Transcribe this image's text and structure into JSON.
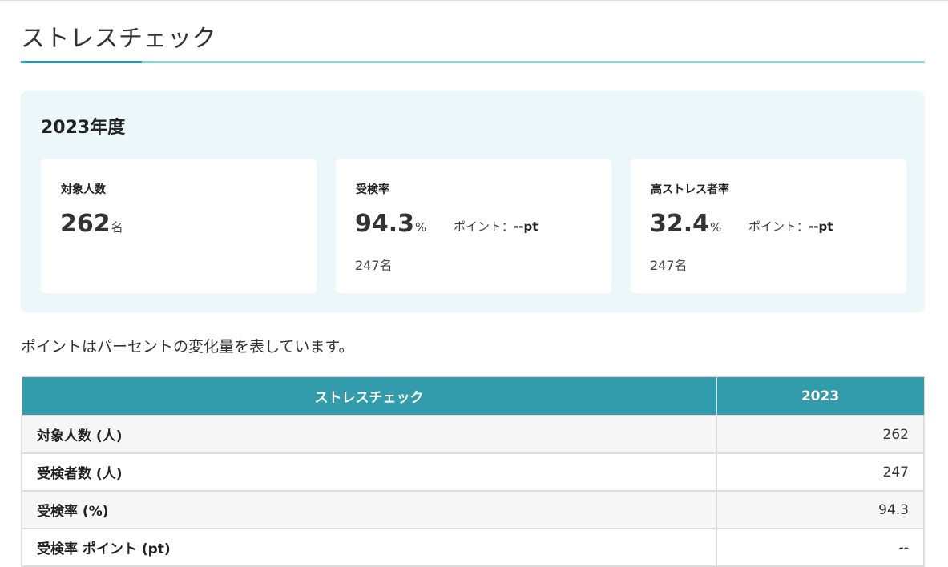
{
  "page": {
    "title": "ストレスチェック"
  },
  "summary": {
    "fiscal_year": "2023年度",
    "cards": [
      {
        "label": "対象人数",
        "value": "262",
        "unit": "名",
        "point_label": "",
        "point_value": "",
        "sub": ""
      },
      {
        "label": "受検率",
        "value": "94.3",
        "unit": "%",
        "point_label": "ポイント：",
        "point_value": "--pt",
        "sub": "247名"
      },
      {
        "label": "高ストレス者率",
        "value": "32.4",
        "unit": "%",
        "point_label": "ポイント：",
        "point_value": "--pt",
        "sub": "247名"
      }
    ]
  },
  "note": "ポイントはパーセントの変化量を表しています。",
  "table": {
    "headers": [
      "ストレスチェック",
      "2023"
    ],
    "rows": [
      {
        "label": "対象人数 (人)",
        "value": "262"
      },
      {
        "label": "受検者数 (人)",
        "value": "247"
      },
      {
        "label": "受検率 (%)",
        "value": "94.3"
      },
      {
        "label": "受検率 ポイント (pt)",
        "value": "--"
      }
    ]
  },
  "colors": {
    "accent": "#2e9eae",
    "accent_light": "#8ed7df",
    "panel_bg": "#ecf7f9",
    "table_header_bg": "#329cac"
  }
}
